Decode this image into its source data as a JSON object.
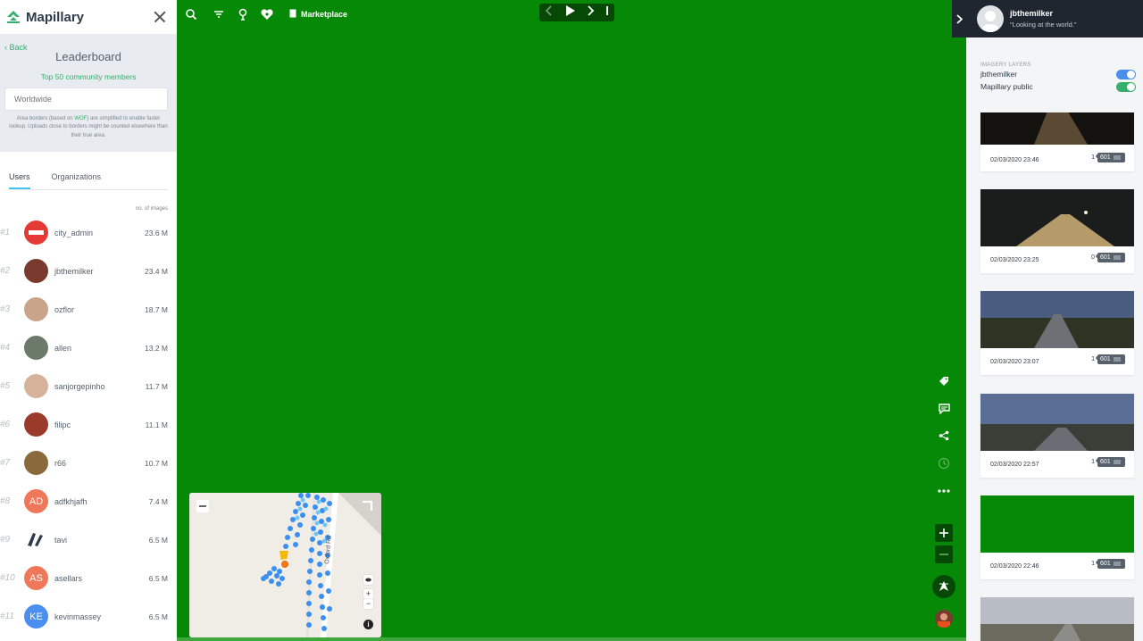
{
  "brand": {
    "name": "Mapillary"
  },
  "leaderboard": {
    "back": "Back",
    "title": "Leaderboard",
    "subtitle": "Top 50 community members",
    "region_placeholder": "Worldwide",
    "note_prefix": "Area borders (based on ",
    "note_link": "WOF",
    "note_suffix": ") are simplified to enable faster lookup. Uploads close to borders might be counted elsewhere than their true area.",
    "tabs": [
      "Users",
      "Organizations"
    ],
    "column_header": "no. of images",
    "users": [
      {
        "rank": "#1",
        "name": "city_admin",
        "count": "23.6 M",
        "color": "#e53935",
        "initials": ""
      },
      {
        "rank": "#2",
        "name": "jbthemilker",
        "count": "23.4 M",
        "color": "#7a3b2e",
        "initials": ""
      },
      {
        "rank": "#3",
        "name": "ozflor",
        "count": "18.7 M",
        "color": "#c9a48a",
        "initials": ""
      },
      {
        "rank": "#4",
        "name": "allen",
        "count": "13.2 M",
        "color": "#6c7a6a",
        "initials": ""
      },
      {
        "rank": "#5",
        "name": "sanjorgepinho",
        "count": "11.7 M",
        "color": "#d7b29a",
        "initials": ""
      },
      {
        "rank": "#6",
        "name": "filipc",
        "count": "11.1 M",
        "color": "#9a3a2a",
        "initials": ""
      },
      {
        "rank": "#7",
        "name": "r66",
        "count": "10.7 M",
        "color": "#8a6a3a",
        "initials": ""
      },
      {
        "rank": "#8",
        "name": "adfkhjafh",
        "count": "7.4 M",
        "color": "#f0785a",
        "initials": "AD"
      },
      {
        "rank": "#9",
        "name": "tavi",
        "count": "6.5 M",
        "color": "#ffffff",
        "initials": ""
      },
      {
        "rank": "#10",
        "name": "asellars",
        "count": "6.5 M",
        "color": "#f0785a",
        "initials": "AS"
      },
      {
        "rank": "#11",
        "name": "kevinmassey",
        "count": "6.5 M",
        "color": "#4a8ef0",
        "initials": "KE"
      }
    ]
  },
  "toolbar": {
    "marketplace": "Marketplace"
  },
  "minimap": {
    "street_label": "Oxford Rd"
  },
  "profile": {
    "username": "jbthemilker",
    "tagline": "\"Looking at the world.\""
  },
  "layers": {
    "title": "IMAGERY LAYERS",
    "items": [
      {
        "name": "jbthemilker",
        "on": true,
        "color": "#4a8ef0"
      },
      {
        "name": "Mapillary public",
        "on": true,
        "color": "#35af6d"
      }
    ]
  },
  "sequences": [
    {
      "date": "02/03/2020 23:46",
      "views": "1",
      "images": "601"
    },
    {
      "date": "02/03/2020 23:25",
      "views": "0",
      "images": "601"
    },
    {
      "date": "02/03/2020 23:07",
      "views": "1",
      "images": "601"
    },
    {
      "date": "02/03/2020 22:57",
      "views": "1",
      "images": "601"
    },
    {
      "date": "02/03/2020 22:46",
      "views": "1",
      "images": "601"
    }
  ],
  "colors": {
    "viewer_green": "#068906",
    "accent": "#35af6d",
    "dark_panel": "#1f2630"
  }
}
